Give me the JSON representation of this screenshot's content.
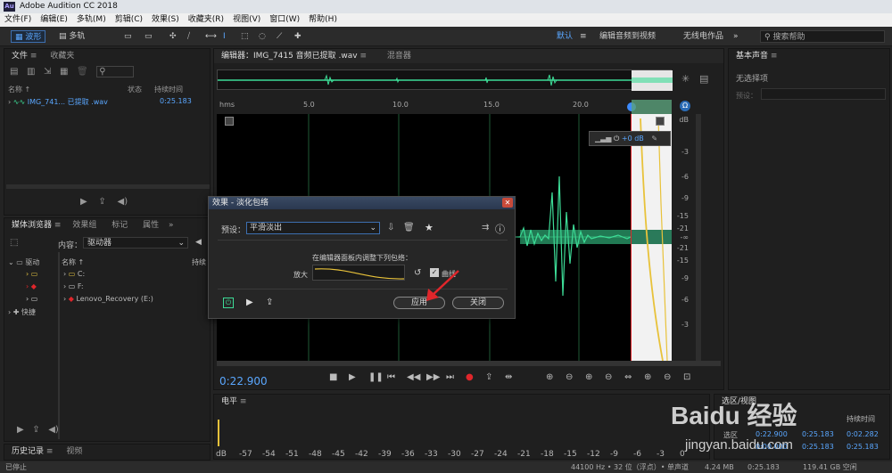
{
  "app": {
    "title": "Adobe Audition CC 2018",
    "logo": "Au"
  },
  "menu": [
    "文件(F)",
    "编辑(E)",
    "多轨(M)",
    "剪辑(C)",
    "效果(S)",
    "收藏夹(R)",
    "视图(V)",
    "窗口(W)",
    "帮助(H)"
  ],
  "toolbar": {
    "waveform_label": "波形",
    "multitrack_label": "多轨",
    "workspace_default": "默认",
    "workspace_edit_video": "编辑音频到视频",
    "workspace_radio": "无线电作品",
    "search_placeholder": "搜索帮助"
  },
  "files_panel": {
    "tab_files": "文件",
    "tab_favorites": "收藏夹",
    "col_name": "名称",
    "col_status": "状态",
    "col_duration": "持续时间",
    "file_name": "IMG_741... 已提取 .wav",
    "file_duration": "0:25.183"
  },
  "media_panel": {
    "tab_media": "媒体浏览器",
    "tab_effects": "效果组",
    "tab_markers": "标记",
    "tab_props": "属性",
    "content_label": "内容：",
    "content_value": "驱动器",
    "col_name": "名称",
    "col_duration": "持续",
    "tree_drives": "驱动",
    "tree_shortcuts": "快捷",
    "drives": [
      "C:",
      "F:",
      "Lenovo_Recovery (E:)"
    ]
  },
  "history_panel": {
    "tab_history": "历史记录",
    "tab_video": "视频"
  },
  "editor": {
    "tab_editor": "编辑器：IMG_7415 音频已提取 .wav",
    "tab_mixer": "混音器",
    "ruler_unit": "hms",
    "ruler_ticks": [
      "5.0",
      "10.0",
      "15.0",
      "20.0"
    ],
    "db_unit": "dB",
    "db_ticks": [
      "-3",
      "-6",
      "-9",
      "-15",
      "-21",
      "-∞",
      "-21",
      "-15",
      "-9",
      "-6",
      "-3"
    ],
    "hud_value": "+0 dB",
    "time_display": "0:22.900"
  },
  "dialog": {
    "title": "效果 - 淡化包络",
    "preset_label": "预设：",
    "preset_value": "平滑淡出",
    "instruction": "在编辑器面板内调整下列包络：",
    "amplify_label": "放大",
    "curve_label": "曲线",
    "apply_label": "应用",
    "close_label": "关闭"
  },
  "essential_sound": {
    "title": "基本声音",
    "no_selection": "无选择项",
    "preset_label": "预设："
  },
  "levels": {
    "title": "电平",
    "scale": [
      "dB",
      "-57",
      "-54",
      "-51",
      "-48",
      "-45",
      "-42",
      "-39",
      "-36",
      "-33",
      "-30",
      "-27",
      "-24",
      "-21",
      "-18",
      "-15",
      "-12",
      "-9",
      "-6",
      "-3",
      "0"
    ]
  },
  "selection_panel": {
    "title": "选区/视图",
    "col_duration": "持续时间",
    "row_selection": "选区",
    "sel_start": "0:22.900",
    "sel_end": "0:25.183",
    "sel_duration": "0:02.282",
    "view_start": "0:00.000",
    "view_end": "0:25.183",
    "view_duration": "0:25.183"
  },
  "status": {
    "left": "已停止",
    "sample": "44100 Hz • 32 位（浮点）• 单声道",
    "size": "4.24 MB",
    "duration": "0:25.183",
    "free": "119.41 GB 空闲"
  },
  "watermark": {
    "brand": "Baidu 经验",
    "url": "jingyan.baidu.com"
  },
  "colors": {
    "wave": "#3ddc97",
    "accent": "#5aa7ff",
    "envelope": "#e8c23a",
    "arrow": "#e0262b",
    "selection": "#f2f2f2"
  }
}
